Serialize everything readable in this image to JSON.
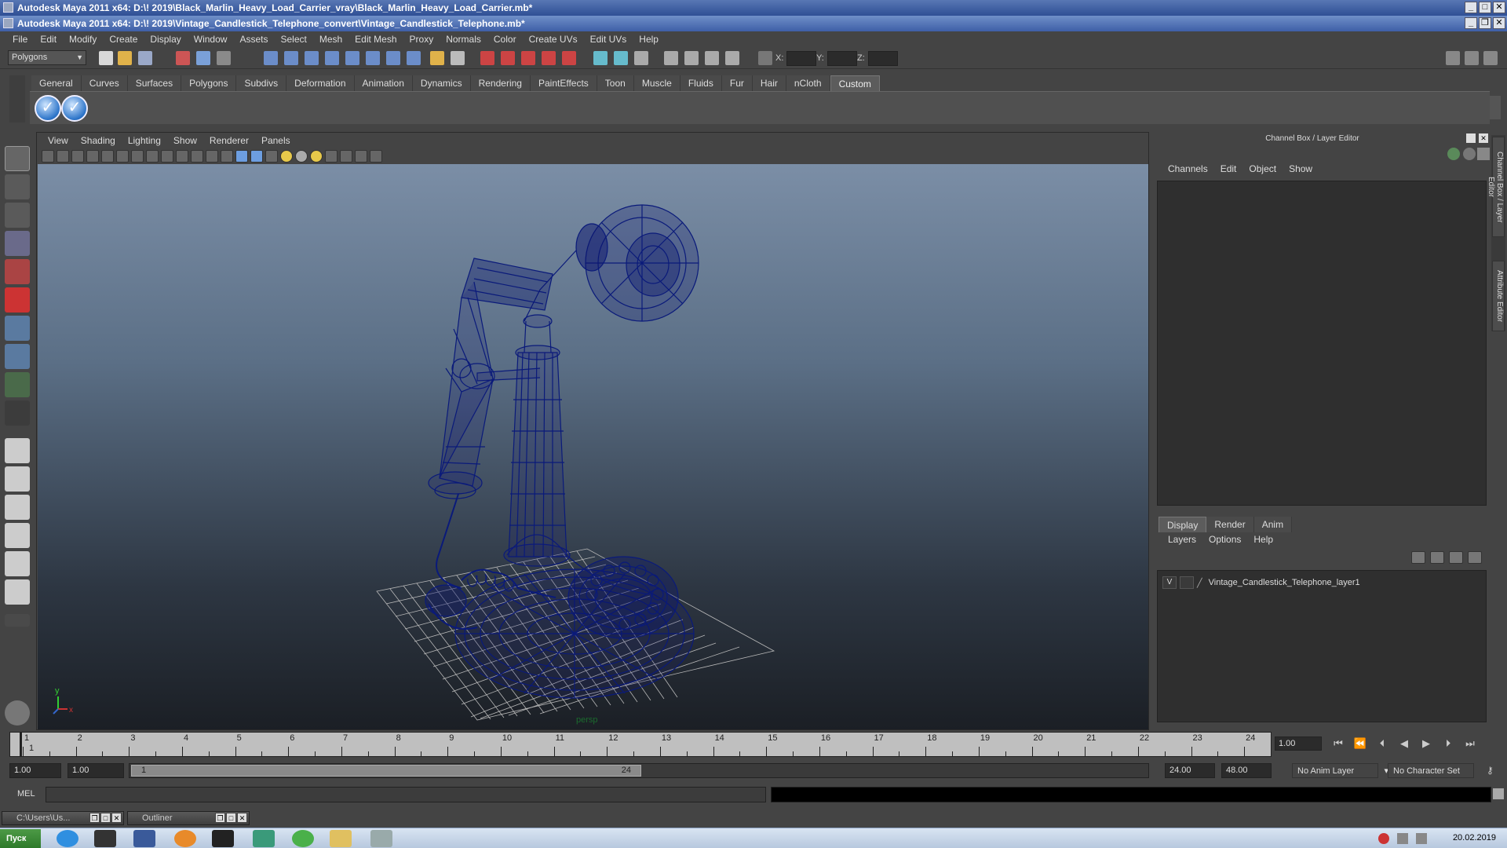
{
  "window": {
    "back_title": "Autodesk Maya 2011 x64: D:\\! 2019\\Black_Marlin_Heavy_Load_Carrier_vray\\Black_Marlin_Heavy_Load_Carrier.mb*",
    "title": "Autodesk Maya 2011 x64: D:\\! 2019\\Vintage_Candlestick_Telephone_convert\\Vintage_Candlestick_Telephone.mb*"
  },
  "menu": [
    "File",
    "Edit",
    "Modify",
    "Create",
    "Display",
    "Window",
    "Assets",
    "Select",
    "Mesh",
    "Edit Mesh",
    "Proxy",
    "Normals",
    "Color",
    "Create UVs",
    "Edit UVs",
    "Help"
  ],
  "status_line": {
    "mode": "Polygons",
    "x_label": "X:",
    "y_label": "Y:",
    "z_label": "Z:"
  },
  "shelf": {
    "tabs": [
      "General",
      "Curves",
      "Surfaces",
      "Polygons",
      "Subdivs",
      "Deformation",
      "Animation",
      "Dynamics",
      "Rendering",
      "PaintEffects",
      "Toon",
      "Muscle",
      "Fluids",
      "Fur",
      "Hair",
      "nCloth",
      "Custom"
    ],
    "active_tab": "Custom"
  },
  "viewport": {
    "menu": [
      "View",
      "Shading",
      "Lighting",
      "Show",
      "Renderer",
      "Panels"
    ],
    "camera_label": "persp",
    "axis_y": "y",
    "axis_x": "x"
  },
  "channel_box": {
    "title": "Channel Box / Layer Editor",
    "menu": [
      "Channels",
      "Edit",
      "Object",
      "Show"
    ]
  },
  "side_tabs": [
    "Channel Box / Layer Editor",
    "Attribute Editor"
  ],
  "layer_editor": {
    "tabs": [
      "Display",
      "Render",
      "Anim"
    ],
    "active_tab": "Display",
    "menu": [
      "Layers",
      "Options",
      "Help"
    ],
    "layers": [
      {
        "visible": "V",
        "name": "Vintage_Candlestick_Telephone_layer1"
      }
    ]
  },
  "time_slider": {
    "ticks": [
      "1",
      "2",
      "3",
      "4",
      "5",
      "6",
      "7",
      "8",
      "9",
      "10",
      "11",
      "12",
      "13",
      "14",
      "15",
      "16",
      "17",
      "18",
      "19",
      "20",
      "21",
      "22",
      "23",
      "24"
    ],
    "current_frame": "1.00",
    "current_marker": "1"
  },
  "range_slider": {
    "start": "1.00",
    "playback_start": "1.00",
    "handle_start": "1",
    "handle_end": "24",
    "playback_end": "24.00",
    "end": "48.00",
    "anim_layer": "No Anim Layer",
    "character_set": "No Character Set"
  },
  "command_line": {
    "label": "MEL"
  },
  "minimized_windows": [
    {
      "label": "C:\\Users\\Us..."
    },
    {
      "label": "Outliner"
    }
  ],
  "taskbar": {
    "start_label": "Пуск",
    "date": "20.02.2019"
  },
  "colors": {
    "wireframe": "#0a1a7a",
    "grid": "#b9b9b9",
    "title_active": "#3e5fa7",
    "shelf_button": "#2c74c9"
  }
}
